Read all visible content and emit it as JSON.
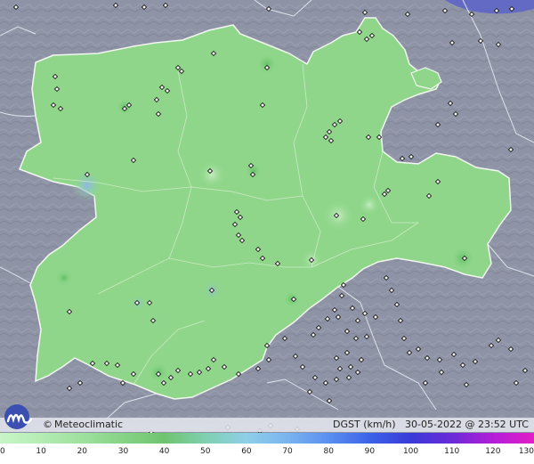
{
  "brand": {
    "copyright": "©",
    "name": "Meteoclimatic"
  },
  "map_info": {
    "variable": "DGST (km/h)",
    "date": "30-05-2022",
    "at": "@",
    "time": "23:52 UTC"
  },
  "legend": {
    "ticks": [
      "0",
      "10",
      "20",
      "30",
      "40",
      "50",
      "60",
      "70",
      "80",
      "90",
      "100",
      "110",
      "120",
      "130"
    ],
    "colors": [
      "#c8f5c8",
      "#b4ecb4",
      "#9ee09e",
      "#86d386",
      "#6fc46f",
      "#7fd0b0",
      "#8fcfe8",
      "#7ab4f0",
      "#5a8ff0",
      "#3c62e8",
      "#3a3ad8",
      "#6a2ad8",
      "#b31ed8",
      "#e21ec8"
    ]
  },
  "region_colors": {
    "land": "#8fd68a",
    "outside": "#8f95a7",
    "station": "#1a1a1a"
  },
  "icons": {
    "logo": "meteoclimatic-logo-icon"
  }
}
